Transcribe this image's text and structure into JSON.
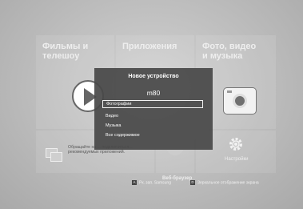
{
  "tiles": {
    "films": "Фильмы и\nтелешоу",
    "apps": "Приложения",
    "photo": "Фото, видео\nи музыка"
  },
  "bottom": {
    "recommended_text": "Обращайте на ... подключиться... рекомендуемых приложений.",
    "web_browser": "Веб-браузер",
    "settings": "Настройки"
  },
  "modal": {
    "title": "Новое устройство",
    "device": "m80",
    "items": [
      "Фотографии",
      "Видео",
      "Музыка",
      "Все содержимое"
    ],
    "selected_index": 0
  },
  "footer": {
    "key_a": "A",
    "hint_a": "Рк. зап. Samsung",
    "key_d": "D",
    "hint_d": "Зеркальное отображение экрана"
  },
  "colors": {
    "background": "#bdbdbd",
    "modal": "#484848",
    "text": "#ffffff"
  },
  "icons": [
    "play-icon",
    "camera-icon",
    "recommended-apps-icon",
    "web-browser-icon",
    "gear-icon"
  ]
}
